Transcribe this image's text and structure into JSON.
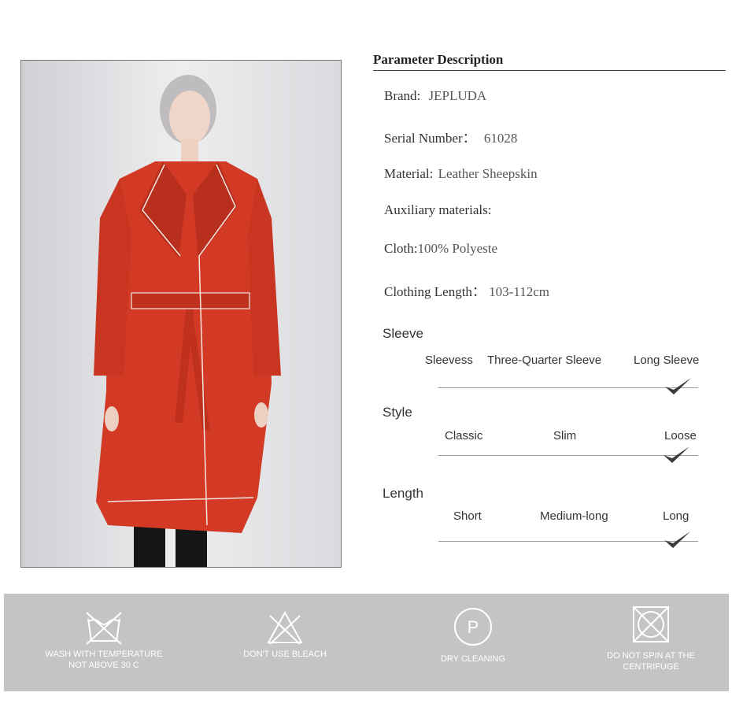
{
  "parameters": {
    "title": "Parameter Description",
    "brand": {
      "label": "Brand:",
      "value": "JEPLUDA"
    },
    "serial": {
      "label": "Serial Number：",
      "value": "61028"
    },
    "material": {
      "label": "Material:",
      "value": "Leather Sheepskin"
    },
    "auxiliary": {
      "label": "Auxiliary  materials:",
      "value": ""
    },
    "cloth": {
      "label": "Cloth:",
      "value": "100% Polyeste"
    },
    "length": {
      "label": "Clothing Length：",
      "value": "103-112cm"
    }
  },
  "attributes": {
    "sleeve": {
      "title": "Sleeve",
      "options": [
        "Sleevess",
        "Three-Quarter Sleeve",
        "Long Sleeve"
      ],
      "selected": "Long Sleeve"
    },
    "style": {
      "title": "Style",
      "options": [
        "Classic",
        "Slim",
        "Loose"
      ],
      "selected": "Loose"
    },
    "length": {
      "title": "Length",
      "options": [
        "Short",
        "Medium-long",
        "Long"
      ],
      "selected": "Long"
    }
  },
  "care": [
    {
      "icon": "wash-30-crossed-icon",
      "lines": [
        "WASH WITH TEMPERATURE",
        "NOT ABOVE 30 C"
      ]
    },
    {
      "icon": "no-bleach-icon",
      "lines": [
        "DON'T USE BLEACH"
      ]
    },
    {
      "icon": "dry-clean-p-icon",
      "lines": [
        "DRY CLEANING"
      ],
      "symbol": "P"
    },
    {
      "icon": "no-tumble-dry-icon",
      "lines": [
        "DO NOT SPIN AT THE",
        "CENTRIFUGE"
      ]
    }
  ],
  "colors": {
    "coat": "#d23a26",
    "band": "#c4c4c7",
    "check": "#3b3b3b"
  }
}
